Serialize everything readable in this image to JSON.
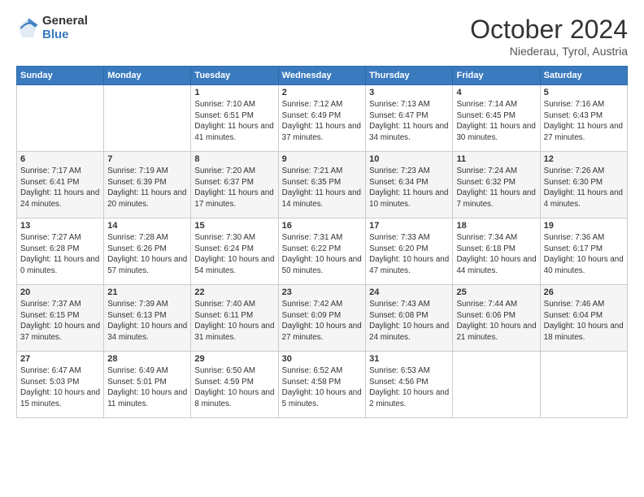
{
  "logo": {
    "general": "General",
    "blue": "Blue"
  },
  "header": {
    "month": "October 2024",
    "location": "Niederau, Tyrol, Austria"
  },
  "weekdays": [
    "Sunday",
    "Monday",
    "Tuesday",
    "Wednesday",
    "Thursday",
    "Friday",
    "Saturday"
  ],
  "weeks": [
    [
      {
        "day": "",
        "sunrise": "",
        "sunset": "",
        "daylight": ""
      },
      {
        "day": "",
        "sunrise": "",
        "sunset": "",
        "daylight": ""
      },
      {
        "day": "1",
        "sunrise": "Sunrise: 7:10 AM",
        "sunset": "Sunset: 6:51 PM",
        "daylight": "Daylight: 11 hours and 41 minutes."
      },
      {
        "day": "2",
        "sunrise": "Sunrise: 7:12 AM",
        "sunset": "Sunset: 6:49 PM",
        "daylight": "Daylight: 11 hours and 37 minutes."
      },
      {
        "day": "3",
        "sunrise": "Sunrise: 7:13 AM",
        "sunset": "Sunset: 6:47 PM",
        "daylight": "Daylight: 11 hours and 34 minutes."
      },
      {
        "day": "4",
        "sunrise": "Sunrise: 7:14 AM",
        "sunset": "Sunset: 6:45 PM",
        "daylight": "Daylight: 11 hours and 30 minutes."
      },
      {
        "day": "5",
        "sunrise": "Sunrise: 7:16 AM",
        "sunset": "Sunset: 6:43 PM",
        "daylight": "Daylight: 11 hours and 27 minutes."
      }
    ],
    [
      {
        "day": "6",
        "sunrise": "Sunrise: 7:17 AM",
        "sunset": "Sunset: 6:41 PM",
        "daylight": "Daylight: 11 hours and 24 minutes."
      },
      {
        "day": "7",
        "sunrise": "Sunrise: 7:19 AM",
        "sunset": "Sunset: 6:39 PM",
        "daylight": "Daylight: 11 hours and 20 minutes."
      },
      {
        "day": "8",
        "sunrise": "Sunrise: 7:20 AM",
        "sunset": "Sunset: 6:37 PM",
        "daylight": "Daylight: 11 hours and 17 minutes."
      },
      {
        "day": "9",
        "sunrise": "Sunrise: 7:21 AM",
        "sunset": "Sunset: 6:35 PM",
        "daylight": "Daylight: 11 hours and 14 minutes."
      },
      {
        "day": "10",
        "sunrise": "Sunrise: 7:23 AM",
        "sunset": "Sunset: 6:34 PM",
        "daylight": "Daylight: 11 hours and 10 minutes."
      },
      {
        "day": "11",
        "sunrise": "Sunrise: 7:24 AM",
        "sunset": "Sunset: 6:32 PM",
        "daylight": "Daylight: 11 hours and 7 minutes."
      },
      {
        "day": "12",
        "sunrise": "Sunrise: 7:26 AM",
        "sunset": "Sunset: 6:30 PM",
        "daylight": "Daylight: 11 hours and 4 minutes."
      }
    ],
    [
      {
        "day": "13",
        "sunrise": "Sunrise: 7:27 AM",
        "sunset": "Sunset: 6:28 PM",
        "daylight": "Daylight: 11 hours and 0 minutes."
      },
      {
        "day": "14",
        "sunrise": "Sunrise: 7:28 AM",
        "sunset": "Sunset: 6:26 PM",
        "daylight": "Daylight: 10 hours and 57 minutes."
      },
      {
        "day": "15",
        "sunrise": "Sunrise: 7:30 AM",
        "sunset": "Sunset: 6:24 PM",
        "daylight": "Daylight: 10 hours and 54 minutes."
      },
      {
        "day": "16",
        "sunrise": "Sunrise: 7:31 AM",
        "sunset": "Sunset: 6:22 PM",
        "daylight": "Daylight: 10 hours and 50 minutes."
      },
      {
        "day": "17",
        "sunrise": "Sunrise: 7:33 AM",
        "sunset": "Sunset: 6:20 PM",
        "daylight": "Daylight: 10 hours and 47 minutes."
      },
      {
        "day": "18",
        "sunrise": "Sunrise: 7:34 AM",
        "sunset": "Sunset: 6:18 PM",
        "daylight": "Daylight: 10 hours and 44 minutes."
      },
      {
        "day": "19",
        "sunrise": "Sunrise: 7:36 AM",
        "sunset": "Sunset: 6:17 PM",
        "daylight": "Daylight: 10 hours and 40 minutes."
      }
    ],
    [
      {
        "day": "20",
        "sunrise": "Sunrise: 7:37 AM",
        "sunset": "Sunset: 6:15 PM",
        "daylight": "Daylight: 10 hours and 37 minutes."
      },
      {
        "day": "21",
        "sunrise": "Sunrise: 7:39 AM",
        "sunset": "Sunset: 6:13 PM",
        "daylight": "Daylight: 10 hours and 34 minutes."
      },
      {
        "day": "22",
        "sunrise": "Sunrise: 7:40 AM",
        "sunset": "Sunset: 6:11 PM",
        "daylight": "Daylight: 10 hours and 31 minutes."
      },
      {
        "day": "23",
        "sunrise": "Sunrise: 7:42 AM",
        "sunset": "Sunset: 6:09 PM",
        "daylight": "Daylight: 10 hours and 27 minutes."
      },
      {
        "day": "24",
        "sunrise": "Sunrise: 7:43 AM",
        "sunset": "Sunset: 6:08 PM",
        "daylight": "Daylight: 10 hours and 24 minutes."
      },
      {
        "day": "25",
        "sunrise": "Sunrise: 7:44 AM",
        "sunset": "Sunset: 6:06 PM",
        "daylight": "Daylight: 10 hours and 21 minutes."
      },
      {
        "day": "26",
        "sunrise": "Sunrise: 7:46 AM",
        "sunset": "Sunset: 6:04 PM",
        "daylight": "Daylight: 10 hours and 18 minutes."
      }
    ],
    [
      {
        "day": "27",
        "sunrise": "Sunrise: 6:47 AM",
        "sunset": "Sunset: 5:03 PM",
        "daylight": "Daylight: 10 hours and 15 minutes."
      },
      {
        "day": "28",
        "sunrise": "Sunrise: 6:49 AM",
        "sunset": "Sunset: 5:01 PM",
        "daylight": "Daylight: 10 hours and 11 minutes."
      },
      {
        "day": "29",
        "sunrise": "Sunrise: 6:50 AM",
        "sunset": "Sunset: 4:59 PM",
        "daylight": "Daylight: 10 hours and 8 minutes."
      },
      {
        "day": "30",
        "sunrise": "Sunrise: 6:52 AM",
        "sunset": "Sunset: 4:58 PM",
        "daylight": "Daylight: 10 hours and 5 minutes."
      },
      {
        "day": "31",
        "sunrise": "Sunrise: 6:53 AM",
        "sunset": "Sunset: 4:56 PM",
        "daylight": "Daylight: 10 hours and 2 minutes."
      },
      {
        "day": "",
        "sunrise": "",
        "sunset": "",
        "daylight": ""
      },
      {
        "day": "",
        "sunrise": "",
        "sunset": "",
        "daylight": ""
      }
    ]
  ]
}
